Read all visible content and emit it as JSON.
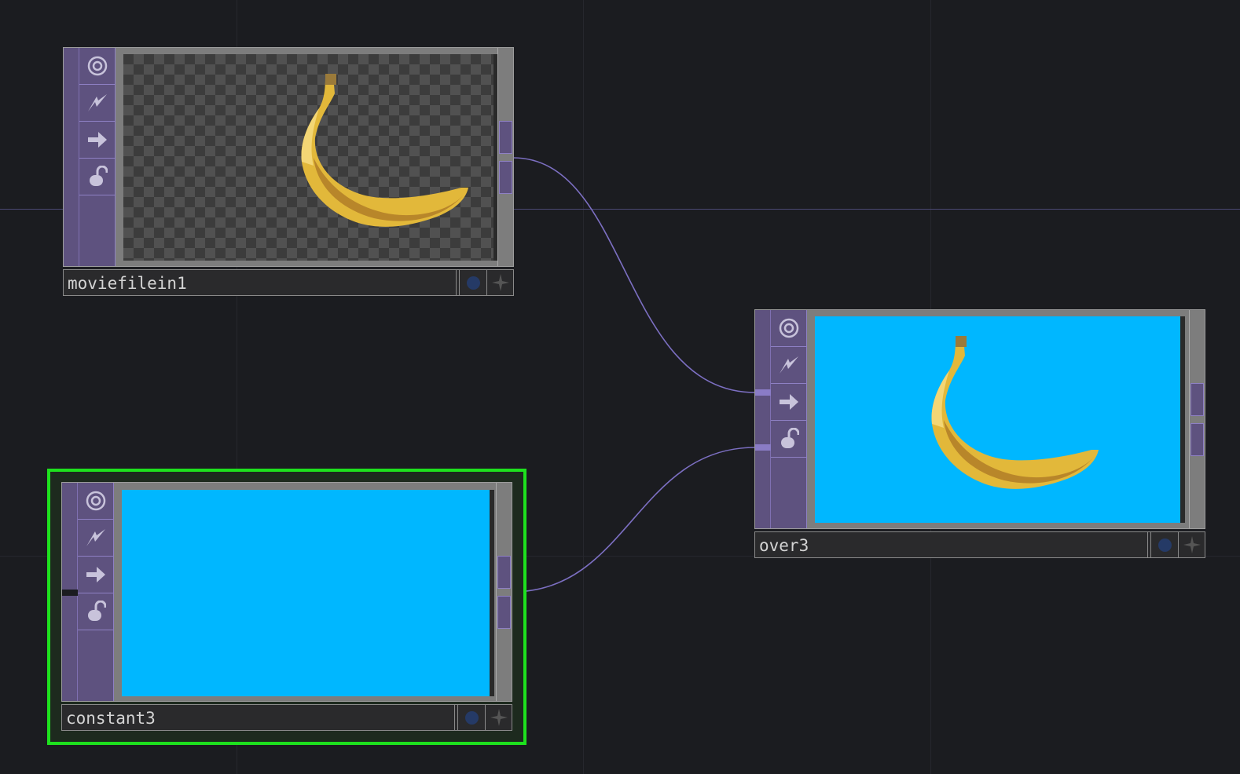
{
  "network": {
    "nodes": [
      {
        "id": "moviefilein1",
        "name": "moviefilein1",
        "viewer": "checker",
        "content": "banana-image",
        "selected": false
      },
      {
        "id": "over3",
        "name": "over3",
        "viewer": "solid",
        "viewer_color": "#00b7ff",
        "content": "banana-image",
        "selected": false
      },
      {
        "id": "constant3",
        "name": "constant3",
        "viewer": "solid",
        "viewer_color": "#00b7ff",
        "content": "none",
        "selected": true
      }
    ],
    "connections": [
      {
        "from": "moviefilein1",
        "to": "over3",
        "input": 1
      },
      {
        "from": "constant3",
        "to": "over3",
        "input": 2
      }
    ],
    "flags": [
      "viewer-flag-icon",
      "cook-flag-icon",
      "bypass-flag-icon",
      "lock-flag-icon"
    ],
    "name_bar_buttons": [
      "viewer-toggle-icon",
      "expand-icon"
    ]
  },
  "colors": {
    "background": "#1b1c20",
    "op_family": "#5e527f",
    "wire": "#7c6fc2",
    "selection": "#1ee11e",
    "constant_color": "#00b7ff",
    "banana": "#e1b539"
  }
}
